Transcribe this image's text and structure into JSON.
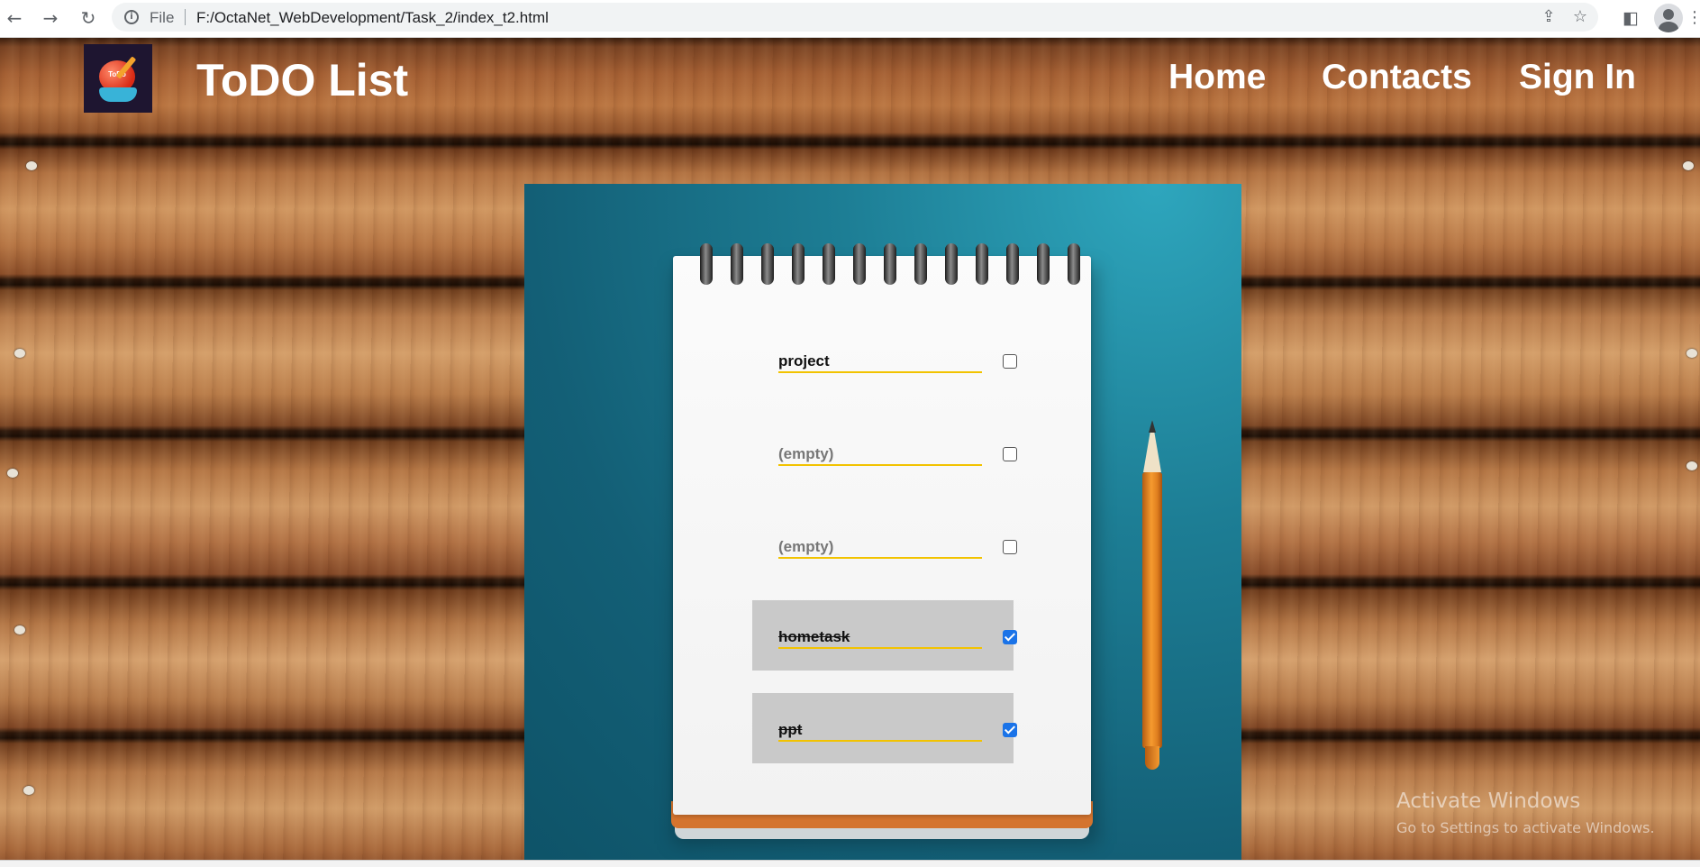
{
  "browser": {
    "back_icon": "arrow-left-icon",
    "forward_icon": "arrow-right-icon",
    "reload_icon": "reload-icon",
    "site_info_icon": "info-icon",
    "scheme_label": "File",
    "url": "F:/OctaNet_WebDevelopment/Task_2/index_t2.html",
    "share_icon": "share-icon",
    "bookmark_icon": "star-icon",
    "sidepanel_icon": "side-panel-icon",
    "profile_icon": "avatar-icon",
    "menu_icon": "kebab-menu-icon"
  },
  "site": {
    "logo_text": "ToDo",
    "title": "ToDO List",
    "nav": [
      {
        "label": "Home"
      },
      {
        "label": "Contacts"
      },
      {
        "label": "Sign In"
      }
    ]
  },
  "todos": [
    {
      "value": "project",
      "placeholder": "(empty)",
      "checked": false
    },
    {
      "value": "",
      "placeholder": "(empty)",
      "checked": false
    },
    {
      "value": "",
      "placeholder": "(empty)",
      "checked": false
    },
    {
      "value": "hometask",
      "placeholder": "(empty)",
      "checked": true
    },
    {
      "value": "ppt",
      "placeholder": "(empty)",
      "checked": true
    }
  ],
  "watermark": {
    "title": "Activate Windows",
    "subtitle": "Go to Settings to activate Windows."
  },
  "colors": {
    "underline": "#f2c300",
    "checkbox_checked": "#1a73e8",
    "done_row_bg": "#c9c9c9",
    "teal_bg": "#135f76"
  }
}
